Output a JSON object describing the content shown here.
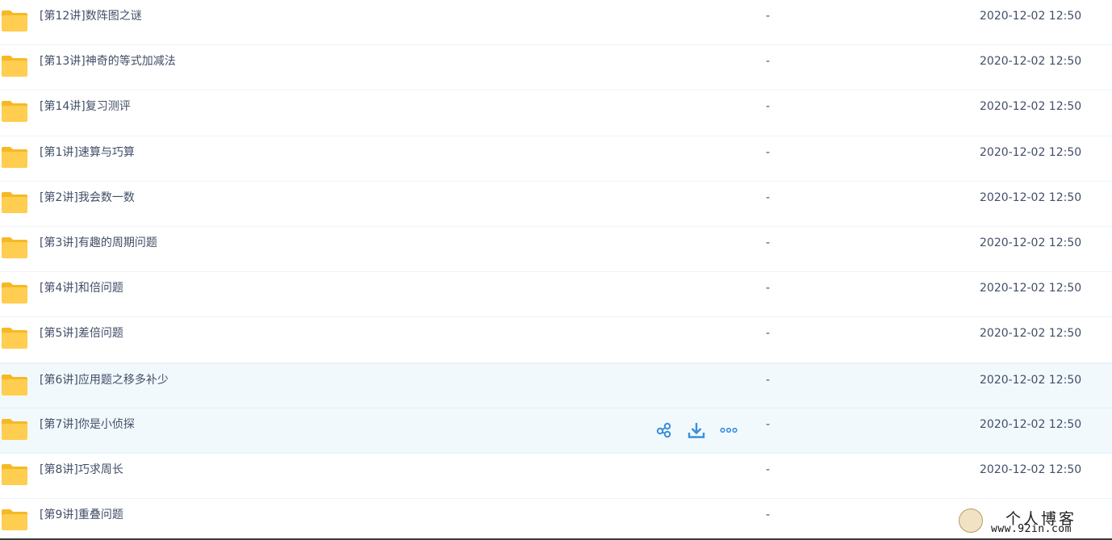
{
  "rows": [
    {
      "name": "[第12讲]数阵图之谜",
      "size": "-",
      "date": "2020-12-02 12:50"
    },
    {
      "name": "[第13讲]神奇的等式加减法",
      "size": "-",
      "date": "2020-12-02 12:50"
    },
    {
      "name": "[第14讲]复习测评",
      "size": "-",
      "date": "2020-12-02 12:50"
    },
    {
      "name": "[第1讲]速算与巧算",
      "size": "-",
      "date": "2020-12-02 12:50"
    },
    {
      "name": "[第2讲]我会数一数",
      "size": "-",
      "date": "2020-12-02 12:50"
    },
    {
      "name": "[第3讲]有趣的周期问题",
      "size": "-",
      "date": "2020-12-02 12:50"
    },
    {
      "name": "[第4讲]和倍问题",
      "size": "-",
      "date": "2020-12-02 12:50"
    },
    {
      "name": "[第5讲]差倍问题",
      "size": "-",
      "date": "2020-12-02 12:50"
    },
    {
      "name": "[第6讲]应用题之移多补少",
      "size": "-",
      "date": "2020-12-02 12:50"
    },
    {
      "name": "[第7讲]你是小侦探",
      "size": "-",
      "date": "2020-12-02 12:50"
    },
    {
      "name": "[第8讲]巧求周长",
      "size": "-",
      "date": "2020-12-02 12:50"
    },
    {
      "name": "[第9讲]重叠问题",
      "size": "-",
      "date": "2020-12-02 12:50"
    }
  ],
  "actions": {
    "share_icon": "share-icon",
    "download_icon": "download-icon",
    "more_icon": "more-icon"
  },
  "watermark": {
    "title": "个人博客",
    "url": "www.92in.com"
  },
  "colors": {
    "folder": "#ffcd4f",
    "folder_tab": "#f5b925",
    "text": "#424e67",
    "action": "#3b8fd9",
    "hover_bg": "#f2f9fd"
  }
}
